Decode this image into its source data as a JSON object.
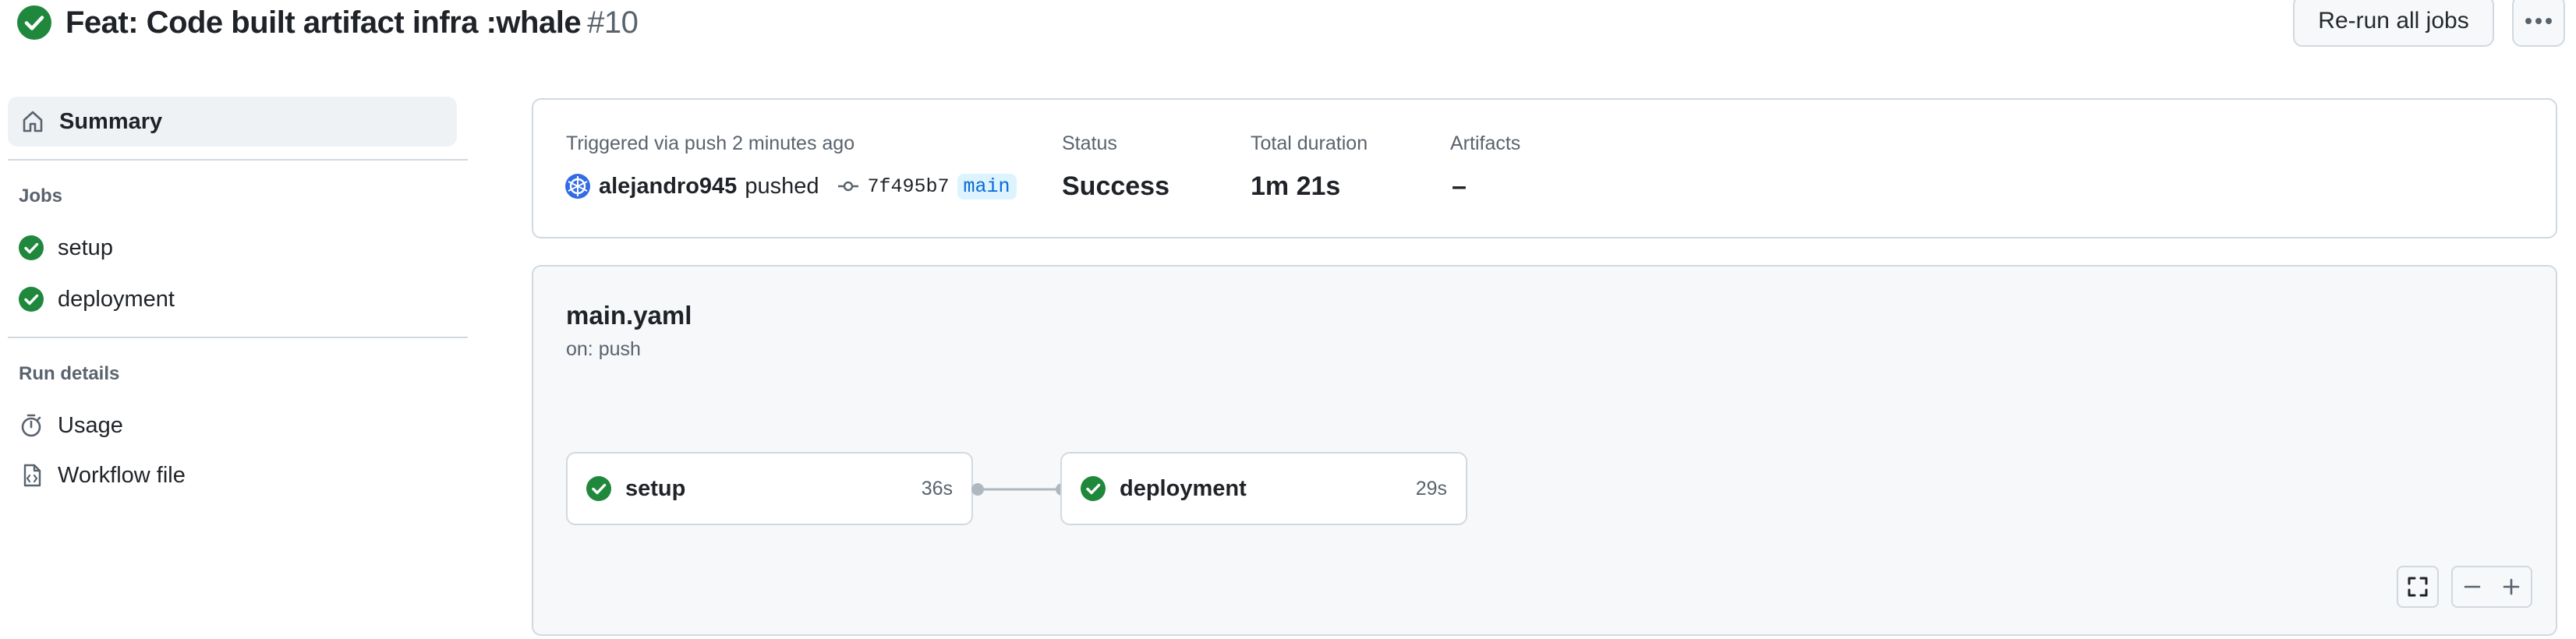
{
  "header": {
    "title": "Feat: Code built artifact infra :whale",
    "run_number": "#10",
    "rerun_label": "Re-run all jobs",
    "more_icon": "kebab-horizontal-icon"
  },
  "sidebar": {
    "summary_label": "Summary",
    "jobs_heading": "Jobs",
    "jobs": [
      {
        "label": "setup",
        "status": "success"
      },
      {
        "label": "deployment",
        "status": "success"
      }
    ],
    "run_details_heading": "Run details",
    "run_details": [
      {
        "label": "Usage",
        "icon": "stopwatch-icon"
      },
      {
        "label": "Workflow file",
        "icon": "file-code-icon"
      }
    ]
  },
  "summary": {
    "trigger_text": "Triggered via push 2 minutes ago",
    "actor": "alejandro945",
    "action": "pushed",
    "commit_sha": "7f495b7",
    "branch": "main",
    "status_label": "Status",
    "status_value": "Success",
    "duration_label": "Total duration",
    "duration_value": "1m 21s",
    "artifacts_label": "Artifacts",
    "artifacts_value": "–"
  },
  "workflow": {
    "filename": "main.yaml",
    "trigger": "on: push",
    "jobs": [
      {
        "name": "setup",
        "duration": "36s"
      },
      {
        "name": "deployment",
        "duration": "29s"
      }
    ]
  },
  "colors": {
    "success": "#1f883d",
    "accent_blue": "#0969da",
    "border": "#d1d9e0",
    "muted_text": "#59636e"
  }
}
